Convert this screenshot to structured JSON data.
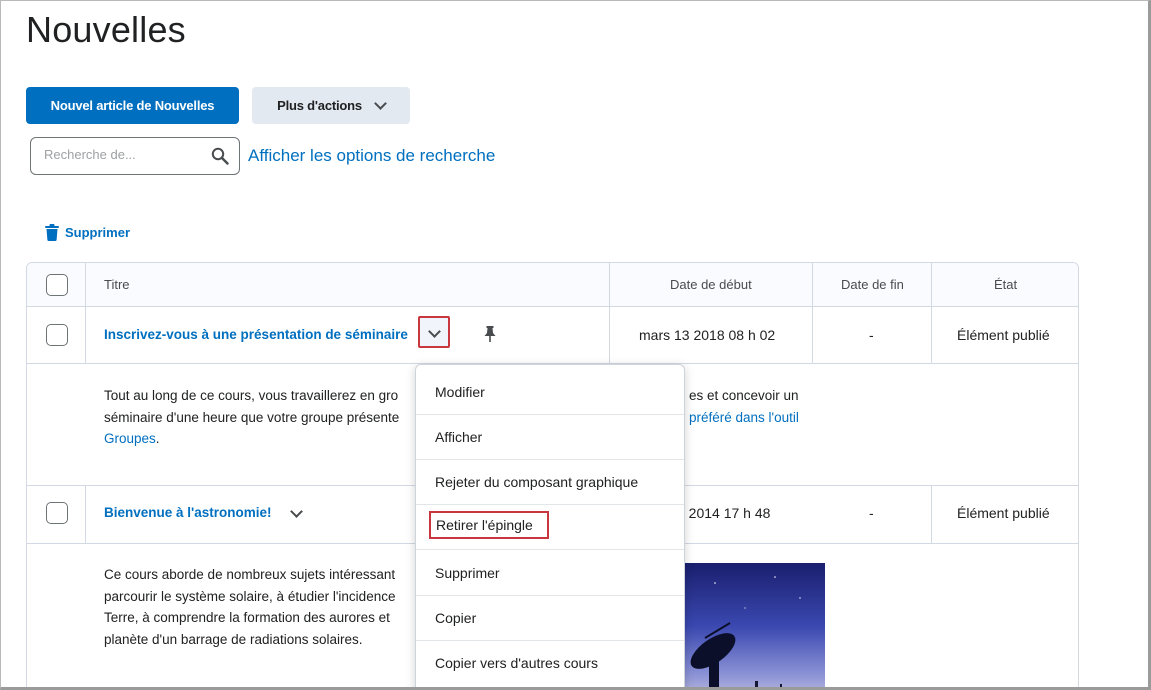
{
  "page": {
    "title": "Nouvelles"
  },
  "toolbar": {
    "new_item_label": "Nouvel article de Nouvelles",
    "more_actions_label": "Plus d'actions"
  },
  "search": {
    "placeholder": "Recherche de...",
    "value": "",
    "options_link": "Afficher les options de recherche"
  },
  "bulk": {
    "delete_label": "Supprimer"
  },
  "table": {
    "headers": {
      "title": "Titre",
      "start_date": "Date de début",
      "end_date": "Date de fin",
      "state": "État"
    },
    "rows": [
      {
        "title": "Inscrivez-vous à une présentation de séminaire",
        "start_date": "mars 13 2018 08 h 02",
        "end_date": "-",
        "state": "Élément publié",
        "body": {
          "line1": "Tout au long de ce cours, vous travaillerez en gro",
          "line1_end": "es et concevoir un",
          "line2": "séminaire d'une heure que votre groupe présente",
          "line2_link": "préféré dans l'outil",
          "line3_link": "Groupes",
          "line3_end": "."
        }
      },
      {
        "title": "Bienvenue à l'astronomie!",
        "start_date": "2 2014 17 h 48",
        "end_date": "-",
        "state": "Élément publié",
        "body": {
          "line1": "Ce cours aborde de nombreux sujets intéressant",
          "line2": "parcourir le système solaire, à étudier l'incidence",
          "line3": "Terre, à comprendre la formation des aurores et",
          "line4": "planète d'un barrage de radiations solaires."
        }
      }
    ]
  },
  "context_menu": {
    "items": [
      "Modifier",
      "Afficher",
      "Rejeter du composant graphique",
      "Retirer l'épingle",
      "Supprimer",
      "Copier",
      "Copier vers d'autres cours"
    ]
  },
  "colors": {
    "accent": "#006fbf",
    "highlight_box": "#c8373d",
    "secondary_button": "#e3e9f1"
  }
}
